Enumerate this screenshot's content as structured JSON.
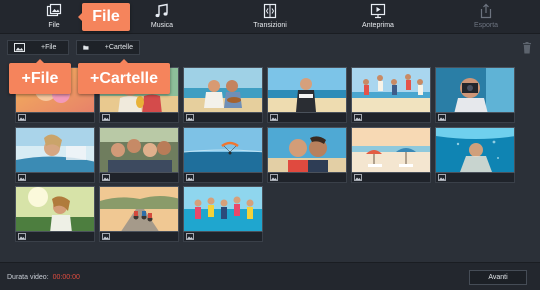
{
  "toolbar": {
    "file_label": "File",
    "music_label": "Musica",
    "transitions_label": "Transizioni",
    "preview_label": "Anteprima",
    "export_label": "Esporta"
  },
  "subbar": {
    "add_files_label": "+File",
    "add_folders_label": "+Cartelle"
  },
  "callouts": {
    "file": "File",
    "add_files": "+File",
    "add_folders": "+Cartelle"
  },
  "thumbnails": [
    {
      "scene": "woman-blowing-bubble-gum"
    },
    {
      "scene": "friends-with-pineapple"
    },
    {
      "scene": "beach-couple-guitar"
    },
    {
      "scene": "woman-on-beach"
    },
    {
      "scene": "friends-jumping-on-beach"
    },
    {
      "scene": "photographer-with-camera"
    },
    {
      "scene": "woman-in-car"
    },
    {
      "scene": "friends-group-selfie"
    },
    {
      "scene": "paraglider-over-sea"
    },
    {
      "scene": "couple-selfie"
    },
    {
      "scene": "beach-umbrellas"
    },
    {
      "scene": "underwater-swimmer"
    },
    {
      "scene": "woman-in-sunlight"
    },
    {
      "scene": "cyclists-on-road"
    },
    {
      "scene": "group-in-sea"
    }
  ],
  "footer": {
    "duration_label": "Durata video:",
    "duration_value": "00:00:00",
    "next_label": "Avanti"
  },
  "colors": {
    "accent": "#f5845c",
    "background": "#2b3038",
    "toolbar": "#23272e",
    "duration_value": "#e04c3f"
  },
  "icons": [
    "file-icon",
    "music-note-icon",
    "transitions-icon",
    "preview-icon",
    "export-icon",
    "image-icon",
    "folder-icon",
    "trash-icon"
  ]
}
